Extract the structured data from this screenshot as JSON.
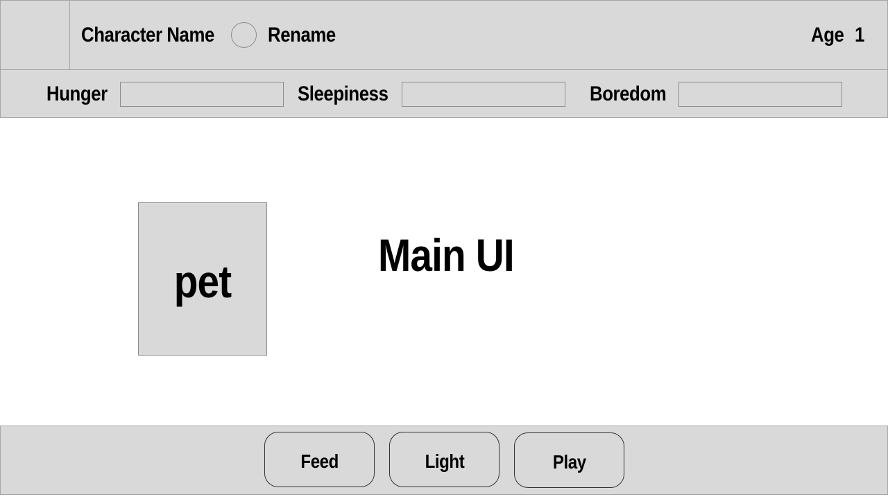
{
  "header": {
    "character_name": "Character Name",
    "rename_label": "Rename",
    "age_label": "Age",
    "age_value": "1"
  },
  "stats": {
    "items": [
      {
        "label": "Hunger",
        "value": 0
      },
      {
        "label": "Sleepiness",
        "value": 0
      },
      {
        "label": "Boredom",
        "value": 0
      }
    ]
  },
  "main": {
    "pet_label": "pet",
    "title": "Main UI"
  },
  "actions": {
    "items": [
      {
        "label": "Feed"
      },
      {
        "label": "Light"
      },
      {
        "label": "Play"
      }
    ]
  },
  "colors": {
    "panel": "#d9d9d9",
    "border": "#a6a6a6",
    "text": "#000000"
  }
}
